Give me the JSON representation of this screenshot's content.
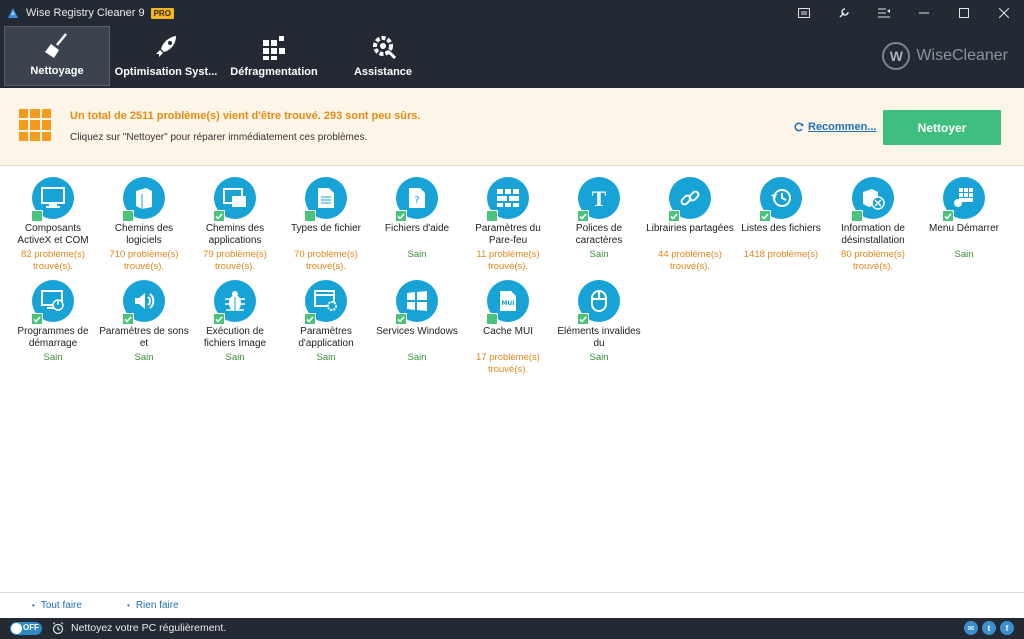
{
  "window": {
    "title": "Wise Registry Cleaner 9",
    "badge": "PRO"
  },
  "nav": {
    "items": [
      {
        "label": "Nettoyage",
        "icon": "broom-icon",
        "active": true
      },
      {
        "label": "Optimisation Syst...",
        "icon": "rocket-icon",
        "active": false
      },
      {
        "label": "Défragmentation",
        "icon": "defrag-icon",
        "active": false
      },
      {
        "label": "Assistance",
        "icon": "tools-icon",
        "active": false
      }
    ],
    "brand": "WiseCleaner",
    "brand_letter": "W"
  },
  "banner": {
    "main_text": "Un total de 2511 problème(s) vient d'être trouvé. 293 sont peu sûrs.",
    "sub_text": "Cliquez sur \"Nettoyer\" pour réparer immédiatement ces problèmes.",
    "recommend_label": "Recommen...",
    "clean_button": "Nettoyer"
  },
  "items": [
    {
      "label": "Composants ActiveX et COM",
      "status": "82 problème(s) trouvé(s).",
      "state": "warn",
      "checked": false,
      "icon": "monitor-icon"
    },
    {
      "label": "Chemins des logiciels",
      "status": "710 problème(s) trouvé(s).",
      "state": "warn",
      "checked": false,
      "icon": "software-box-icon"
    },
    {
      "label": "Chemins des applications",
      "status": "79 problème(s) trouvé(s).",
      "state": "warn",
      "checked": true,
      "icon": "app-windows-icon"
    },
    {
      "label": "Types de fichier",
      "status": "70 problème(s) trouvé(s).",
      "state": "warn",
      "checked": false,
      "icon": "file-type-icon"
    },
    {
      "label": "Fichiers d'aide",
      "status": "Sain",
      "state": "ok",
      "checked": true,
      "icon": "help-file-icon"
    },
    {
      "label": "Paramètres du Pare-feu",
      "status": "11 problème(s) trouvé(s).",
      "state": "warn",
      "checked": false,
      "icon": "firewall-icon"
    },
    {
      "label": "Polices de caractères",
      "status": "Sain",
      "state": "ok",
      "checked": true,
      "icon": "font-icon"
    },
    {
      "label": "Librairies partagées",
      "status": "44 problème(s) trouvé(s).",
      "state": "warn",
      "checked": true,
      "icon": "link-icon"
    },
    {
      "label": "Listes des fichiers",
      "status": "1418 problème(s)",
      "state": "warn",
      "checked": true,
      "icon": "history-icon"
    },
    {
      "label": "Information de désinstallation",
      "status": "80 problème(s) trouvé(s).",
      "state": "warn",
      "checked": false,
      "icon": "uninstall-icon"
    },
    {
      "label": "Menu Démarrer",
      "status": "Sain",
      "state": "ok",
      "checked": true,
      "icon": "start-menu-icon"
    },
    {
      "label": "Programmes de démarrage",
      "status": "Sain",
      "state": "ok",
      "checked": true,
      "icon": "startup-icon"
    },
    {
      "label": "Paramètres de sons et",
      "status": "Sain",
      "state": "ok",
      "checked": true,
      "icon": "speaker-icon"
    },
    {
      "label": "Exécution de fichiers Image",
      "status": "Sain",
      "state": "ok",
      "checked": true,
      "icon": "bug-icon"
    },
    {
      "label": "Paramètres d'application",
      "status": "Sain",
      "state": "ok",
      "checked": true,
      "icon": "app-settings-icon"
    },
    {
      "label": "Services Windows",
      "status": "Sain",
      "state": "ok",
      "checked": true,
      "icon": "windows-icon"
    },
    {
      "label": "Cache MUI",
      "status": "17 problème(s) trouvé(s).",
      "state": "warn",
      "checked": false,
      "icon": "mui-file-icon"
    },
    {
      "label": "Eléments invalides du",
      "status": "Sain",
      "state": "ok",
      "checked": true,
      "icon": "mouse-icon"
    }
  ],
  "footer": {
    "select_all": "Tout faire",
    "select_none": "Rien faire"
  },
  "statusbar": {
    "toggle_label": "OFF",
    "text": "Nettoyez votre PC régulièrement."
  },
  "colors": {
    "accent": "#17a3d6",
    "warn": "#e0861b",
    "ok": "#3a8e3a",
    "clean_button": "#3fbf7f",
    "banner_text": "#e88b12"
  }
}
